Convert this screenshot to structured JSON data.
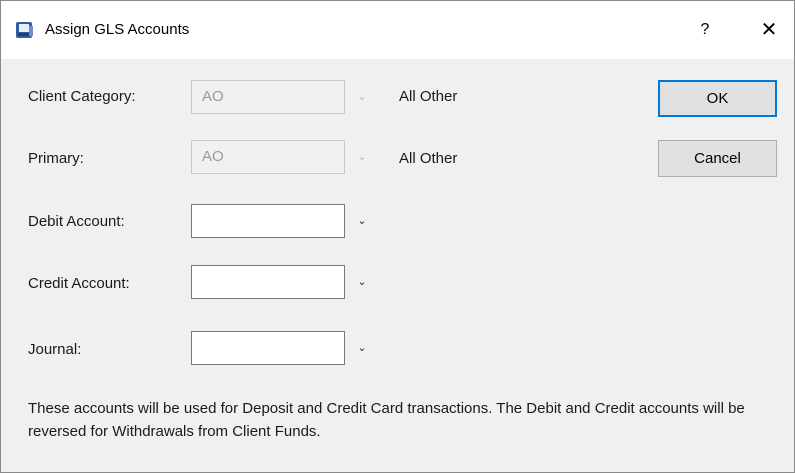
{
  "window": {
    "title": "Assign GLS Accounts",
    "help_label": "?",
    "close_label": "✕"
  },
  "icons": {
    "app": "app-icon",
    "dropdown": "chevron-down-icon",
    "help": "help-icon",
    "close": "close-icon"
  },
  "form": {
    "client_category": {
      "label": "Client Category:",
      "value": "AO",
      "description": "All Other",
      "enabled": false
    },
    "primary": {
      "label": "Primary:",
      "value": "AO",
      "description": "All Other",
      "enabled": false
    },
    "debit_account": {
      "label": "Debit Account:",
      "value": ""
    },
    "credit_account": {
      "label": "Credit Account:",
      "value": ""
    },
    "journal": {
      "label": "Journal:",
      "value": ""
    }
  },
  "buttons": {
    "ok": "OK",
    "cancel": "Cancel"
  },
  "note": "These accounts will be used for Deposit and Credit Card transactions. The Debit and Credit accounts will be reversed for Withdrawals from Client Funds.",
  "colors": {
    "accent": "#0078d7",
    "background": "#f0f0f0",
    "titlebar": "#ffffff"
  }
}
